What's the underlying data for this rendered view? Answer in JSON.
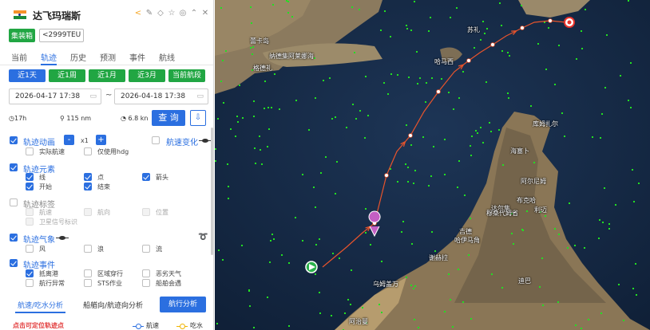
{
  "ship": {
    "name": "达飞玛瑞斯",
    "type_tag": "集装箱",
    "size_tag": "<2999TEU"
  },
  "tabs": [
    "当前",
    "轨迹",
    "历史",
    "预测",
    "事件",
    "航线"
  ],
  "active_tab": "轨迹",
  "range_buttons": [
    "近1天",
    "近1周",
    "近1月",
    "近3月",
    "当前航段"
  ],
  "dates": {
    "start": "2026-04-17 17:38",
    "separator": "~",
    "end": "2026-04-18 17:38"
  },
  "stats": {
    "duration": "17h",
    "distance": "115 nm",
    "speed": "6.8 kn"
  },
  "query_label": "查 询",
  "sections": {
    "anim": {
      "label": "轨迹动画",
      "speed": "x1",
      "minus": "-",
      "plus": "+",
      "opt1": "实际航速",
      "opt2": "仅使用hdg"
    },
    "speed_change": {
      "label": "航速变化"
    },
    "elements": {
      "label": "轨迹元素",
      "line": "线",
      "point": "点",
      "arrow": "箭头",
      "start": "开始",
      "end": "结束"
    },
    "tags": {
      "label": "轨迹标签",
      "speed": "航速",
      "heading": "航向",
      "position": "位置",
      "satellite": "卫星信号标识"
    },
    "weather": {
      "label": "轨迹气象",
      "wind": "风",
      "wave": "浪",
      "current": "流"
    },
    "events": {
      "label": "轨迹事件",
      "port": "抵离港",
      "area": "区域穿行",
      "bad_weather": "恶劣天气",
      "abnormal": "航行异常",
      "sts": "STS作业",
      "encounter": "船舶会遇"
    }
  },
  "bottom_tabs": [
    "航速/吃水分析",
    "船艏向/航迹向分析",
    "航行分析"
  ],
  "footnote": "点击可定位轨迹点",
  "legend": {
    "speed": "航速",
    "draft": "吃水"
  },
  "map_labels": [
    "苏礼",
    "蕾卡岛",
    "纳德集阿莱娜海",
    "格德礼",
    "哈马西",
    "库姆扎尔",
    "海塞卜",
    "阿尔尼姆",
    "布克哈",
    "达尔集",
    "吉德",
    "穆桑代姆省",
    "利迈",
    "哈伊马角",
    "迪巴",
    "谢赫拉",
    "乌姆盖万",
    "阿治曼"
  ],
  "colors": {
    "accent": "#2b6fe0",
    "green": "#21a643",
    "track": "#e8542c",
    "vessel": "#22e022"
  }
}
